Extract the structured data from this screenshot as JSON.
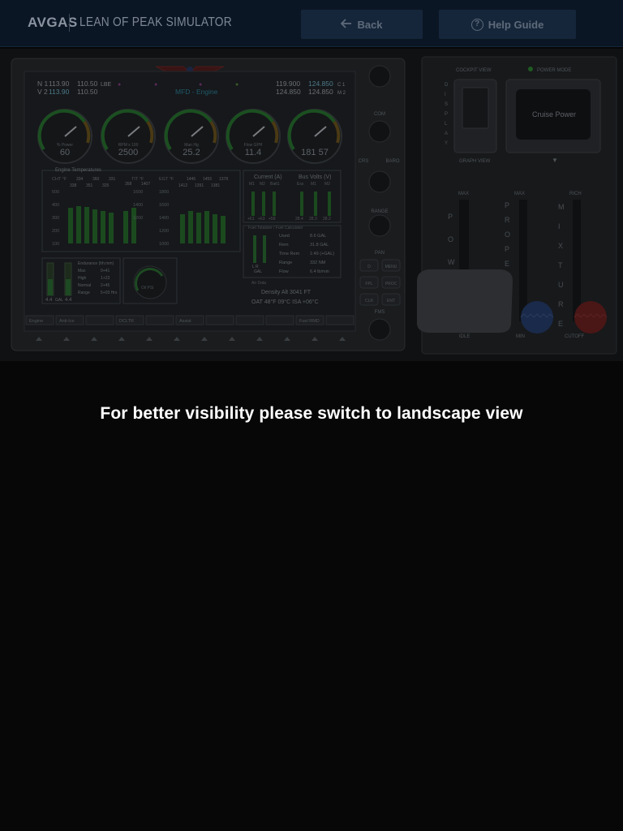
{
  "header": {
    "logo": "AVGAS",
    "title": "LEAN OF PEAK SIMULATOR",
    "back_label": "Back",
    "help_label": "Help Guide",
    "help_glyph": "?"
  },
  "mfd": {
    "nav1": "113.90",
    "nav1_standby": "110.50",
    "nav1_id": "LBE",
    "nav2": "113.90",
    "nav2_standby": "110.50",
    "nav_tag1": "N 1",
    "nav_tag2": "V 2",
    "com1_active": "119.900",
    "com1_standby": "124.850",
    "com2_active": "124.850",
    "com2_standby": "124.850",
    "com_tag1": "C 1",
    "com_tag2": "M 2",
    "page_label": "MFD - Engine",
    "gauges": [
      {
        "label": "% Power",
        "value": "60"
      },
      {
        "label": "RPM x 100",
        "value": "2500"
      },
      {
        "label": "Man Hg",
        "value": "25.2"
      },
      {
        "label": "Flow GPH",
        "value": "11.4"
      },
      {
        "label": "",
        "value": "181  57"
      }
    ],
    "engine_temp_title": "Engine Temperatures",
    "cht_label": "CHT °F",
    "cht_values": [
      "334",
      "360",
      "331"
    ],
    "cht_values2": [
      "338",
      "351",
      "325"
    ],
    "tit_label": "TIT °F",
    "tit_values": [
      "358",
      "1407"
    ],
    "egt_label": "EGT °F",
    "egt_values": [
      "1446",
      "1455",
      "1378"
    ],
    "egt_values2": [
      "1412",
      "1391",
      "1381"
    ],
    "cht_ticks": [
      "500",
      "400",
      "300",
      "200",
      "100"
    ],
    "tit_ticks": [
      "1600",
      "1400",
      "1200"
    ],
    "egt_ticks": [
      "1800",
      "1600",
      "1400",
      "1200",
      "1000"
    ],
    "current_label": "Current (A)",
    "bus_volts_label": "Bus Volts (V)",
    "current_cols": [
      "M1",
      "M2",
      "Batt1"
    ],
    "bus_cols": [
      "Ess",
      "M1",
      "M2"
    ],
    "current_vals": [
      "+61",
      "+63",
      "+58"
    ],
    "bus_vals": [
      "28.4",
      "28.3",
      "28.2"
    ],
    "fuel_calc_label": "Fuel Totalizer / Fuel Calculator",
    "fuel_rows": [
      {
        "key": "Used",
        "val": "8.6 GAL"
      },
      {
        "key": "Rem",
        "val": "31.8 GAL"
      },
      {
        "key": "Time Rem",
        "val": "1:49 (+GAL)"
      },
      {
        "key": "Range",
        "val": "332 NM"
      },
      {
        "key": "Flow",
        "val": "6.4 lb/min"
      }
    ],
    "fuel_side_label": "L  R",
    "fuel_unit": "GAL",
    "fuel_left": "4.4",
    "fuel_right": "4.4",
    "fuel_mid": "GAL",
    "endurance_rows": [
      {
        "key": "Endurance (hh:mm)",
        "val": ""
      },
      {
        "key": "Max",
        "val": "0+41"
      },
      {
        "key": "High",
        "val": "1+23"
      },
      {
        "key": "Normal",
        "val": "2+45"
      },
      {
        "key": "Range",
        "val": "5+03 Hrs"
      }
    ],
    "oil_label": "Oil PSI",
    "air_data_label": "Air Data",
    "density_alt": "Density Alt   3041 FT",
    "oat_line": "OAT  48°F  09°C  ISA +06°C",
    "softkeys": [
      "Engine",
      "Anti-Ice",
      "",
      "DCLTR",
      "",
      "Assist",
      "",
      "",
      "",
      "Fuel RMD",
      ""
    ],
    "side_labels": [
      "VOL PUSH ID",
      "SWAP",
      "COM",
      "1-2",
      "CRS",
      "BARO",
      "PUSH CRS CTR",
      "RANGE",
      "PUSH PAN",
      "PAN",
      "MENU",
      "FPL",
      "PROC",
      "CLR",
      "ENT",
      "FMS",
      "PUSH CRSR"
    ],
    "side_btns": [
      "D",
      "MENU",
      "FPL",
      "PROC",
      "CLR",
      "ENT"
    ]
  },
  "controls": {
    "cockpit_view": "COCKPIT VIEW",
    "power_mode": "POWER MODE",
    "graph_view": "GRAPH VIEW",
    "display_letters": [
      "D",
      "I",
      "S",
      "P",
      "L",
      "A",
      "Y"
    ],
    "mode_value": "Cruise Power",
    "power_letters": [
      "P",
      "O",
      "W"
    ],
    "prop_letters": [
      "P",
      "R",
      "O",
      "P",
      "E",
      "L",
      "L",
      "E",
      "R"
    ],
    "mix_letters": [
      "M",
      "I",
      "X",
      "T",
      "U",
      "R",
      "E"
    ],
    "max_label": "MAX",
    "rich_label": "RICH",
    "idle_label": "IDLE",
    "min_label": "MIN",
    "cutoff_label": "CUTOFF"
  },
  "message": "For better visibility please switch to landscape view",
  "colors": {
    "header_bg": "#0b1624",
    "button_bg": "#16263a",
    "green_bar": "#1f8a2a",
    "page_bg": "#070707"
  }
}
